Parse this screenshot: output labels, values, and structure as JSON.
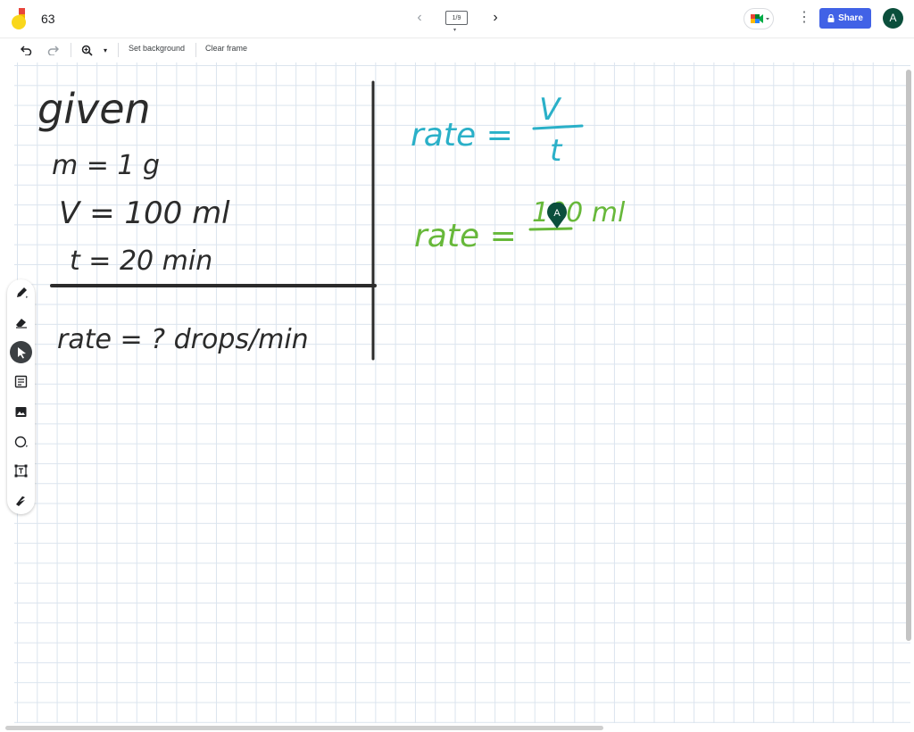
{
  "header": {
    "doc_title": "63",
    "frame_counter": "1/9",
    "share_label": "Share",
    "avatar_initial": "A",
    "icons": {
      "logo": "jamboard-logo-icon",
      "prev": "chevron-left-icon",
      "next": "chevron-right-icon",
      "meet": "google-meet-icon",
      "more": "more-vert-icon",
      "lock": "lock-icon"
    }
  },
  "toolbar": {
    "set_background_label": "Set background",
    "clear_frame_label": "Clear frame",
    "icons": [
      "undo-icon",
      "redo-icon",
      "zoom-icon",
      "chevron-down-icon"
    ]
  },
  "tools": [
    "pen-icon",
    "eraser-icon",
    "select-icon",
    "sticky-note-icon",
    "image-icon",
    "circle-icon",
    "text-box-icon",
    "laser-icon"
  ],
  "canvas": {
    "given_heading": "given",
    "given_m": "m = 1 g",
    "given_V": "V = 100 ml",
    "given_t": "t = 20 min",
    "unknown": "rate = ? drops/min",
    "formula_lhs": "rate =",
    "formula_num": "V",
    "formula_den": "t",
    "step2_lhs": "rate =",
    "step2_num": "100 ml",
    "cursor_initial": "A",
    "colors": {
      "black_ink": "#2b2b2b",
      "blue_ink": "#2ab0c8",
      "green_ink": "#67b83a",
      "cursor": "#0b4f3c"
    }
  },
  "colors": {
    "share": "#4162e6",
    "avatar": "#0b4f3c",
    "grid": "#dbe4ee"
  }
}
